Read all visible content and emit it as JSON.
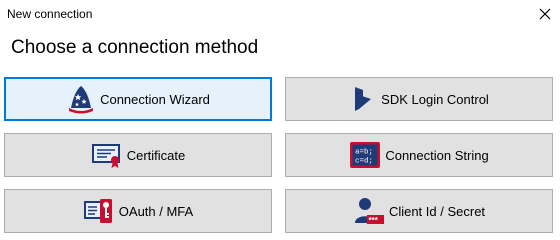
{
  "window": {
    "title": "New connection"
  },
  "heading": "Choose a connection method",
  "buttons": {
    "connection_wizard": {
      "label": "Connection Wizard",
      "icon": "wizard-hat-icon"
    },
    "sdk_login_control": {
      "label": "SDK Login Control",
      "icon": "dynamics-logo-icon"
    },
    "certificate": {
      "label": "Certificate",
      "icon": "certificate-icon"
    },
    "connection_string": {
      "label": "Connection String",
      "icon": "connection-string-icon",
      "icon_text": [
        "a=b;",
        "c=d;"
      ]
    },
    "oauth_mfa": {
      "label": "OAuth / MFA",
      "icon": "oauth-key-icon"
    },
    "client_id_secret": {
      "label": "Client Id / Secret",
      "icon": "user-secret-icon",
      "icon_text": "***"
    }
  },
  "colors": {
    "focus_border": "#0078d7",
    "button_bg": "#e1e1e1",
    "button_border": "#adadad",
    "icon_navy": "#1f3a78",
    "icon_red": "#c8102e"
  }
}
